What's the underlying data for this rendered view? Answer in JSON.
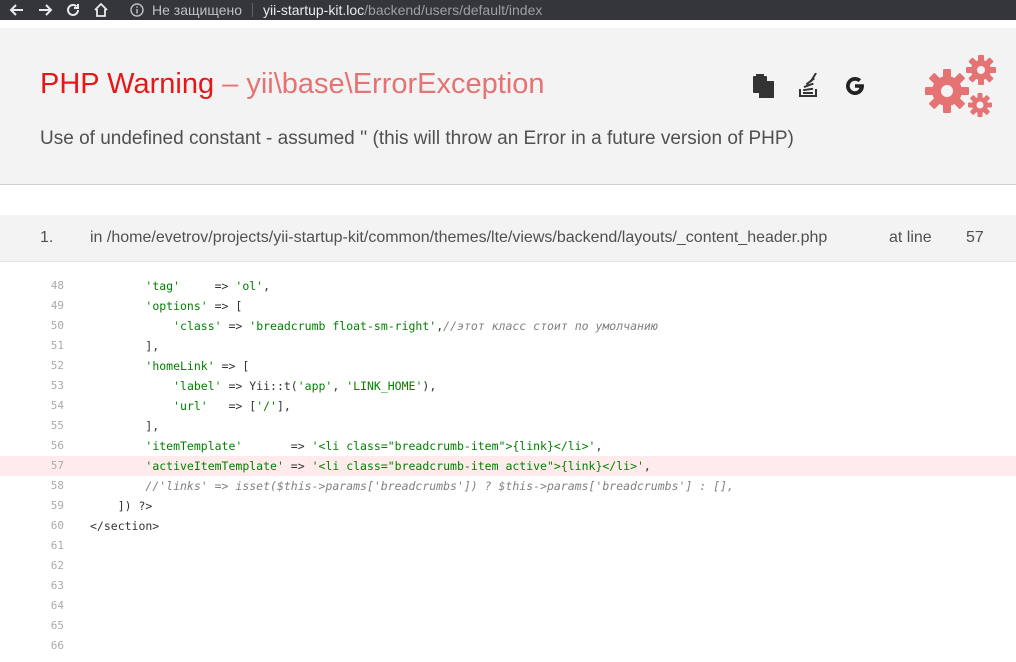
{
  "browser": {
    "security_text": "Не защищено",
    "url_host": "yii-startup-kit.loc",
    "url_path": "/backend/users/default/index"
  },
  "error": {
    "type": "PHP Warning",
    "dash": " – ",
    "class": "yii\\base\\ErrorException",
    "message": "Use of undefined constant  - assumed '' (this will throw an Error in a future version of PHP)"
  },
  "toolbar_icons": [
    "copy-icon",
    "stackoverflow-icon",
    "google-icon"
  ],
  "colors": {
    "error_red": "#e51717",
    "error_light": "#e57373",
    "highlight": "#ffebeb"
  },
  "call_stack": [
    {
      "index": "1.",
      "file": "in /home/evetrov/projects/yii-startup-kit/common/themes/lte/views/backend/layouts/_content_header.php",
      "at_line_label": "at line",
      "line": "57"
    }
  ],
  "code": {
    "highlight_line": 57,
    "lines": [
      {
        "n": "48",
        "segs": [
          [
            "p",
            "        "
          ],
          [
            "s",
            "'tag'"
          ],
          [
            "p",
            "     => "
          ],
          [
            "s",
            "'ol'"
          ],
          [
            "p",
            ","
          ]
        ]
      },
      {
        "n": "49",
        "segs": [
          [
            "p",
            "        "
          ],
          [
            "s",
            "'options'"
          ],
          [
            "p",
            " => ["
          ]
        ]
      },
      {
        "n": "50",
        "segs": [
          [
            "p",
            "            "
          ],
          [
            "s",
            "'class'"
          ],
          [
            "p",
            " => "
          ],
          [
            "s",
            "'breadcrumb float-sm-right'"
          ],
          [
            "p",
            ","
          ],
          [
            "c",
            "//этот класс стоит по умолчанию"
          ]
        ]
      },
      {
        "n": "51",
        "segs": [
          [
            "p",
            "        ],"
          ]
        ]
      },
      {
        "n": "52",
        "segs": [
          [
            "p",
            "        "
          ],
          [
            "s",
            "'homeLink'"
          ],
          [
            "p",
            " => ["
          ]
        ]
      },
      {
        "n": "53",
        "segs": [
          [
            "p",
            "            "
          ],
          [
            "s",
            "'label'"
          ],
          [
            "p",
            " => Yii::t("
          ],
          [
            "s",
            "'app'"
          ],
          [
            "p",
            ", "
          ],
          [
            "s",
            "'LINK_HOME'"
          ],
          [
            "p",
            "),"
          ]
        ]
      },
      {
        "n": "54",
        "segs": [
          [
            "p",
            "            "
          ],
          [
            "s",
            "'url'"
          ],
          [
            "p",
            "   => ["
          ],
          [
            "s",
            "'/'"
          ],
          [
            "p",
            "],"
          ]
        ]
      },
      {
        "n": "55",
        "segs": [
          [
            "p",
            "        ],"
          ]
        ]
      },
      {
        "n": "56",
        "segs": [
          [
            "p",
            "        "
          ],
          [
            "s",
            "'itemTemplate'"
          ],
          [
            "p",
            "       => "
          ],
          [
            "s",
            "'<li class=\"breadcrumb-item\">{link}</li>'"
          ],
          [
            "p",
            ","
          ]
        ]
      },
      {
        "n": "57",
        "segs": [
          [
            "p",
            "        "
          ],
          [
            "s",
            "'activeItemTemplate'"
          ],
          [
            "p",
            " => "
          ],
          [
            "s",
            "'<li class=\"breadcrumb-item active\">{link}</li>'"
          ],
          [
            "p",
            ","
          ]
        ]
      },
      {
        "n": "58",
        "segs": [
          [
            "p",
            "        "
          ],
          [
            "c",
            "//'links' => isset($this->params['breadcrumbs']) ? $this->params['breadcrumbs'] : [],"
          ]
        ]
      },
      {
        "n": "59",
        "segs": [
          [
            "p",
            "    ]) ?>"
          ]
        ]
      },
      {
        "n": "60",
        "segs": [
          [
            "p",
            "</section>"
          ]
        ]
      },
      {
        "n": "61",
        "segs": []
      },
      {
        "n": "62",
        "segs": []
      },
      {
        "n": "63",
        "segs": []
      },
      {
        "n": "64",
        "segs": []
      },
      {
        "n": "65",
        "segs": []
      },
      {
        "n": "66",
        "segs": []
      }
    ]
  }
}
